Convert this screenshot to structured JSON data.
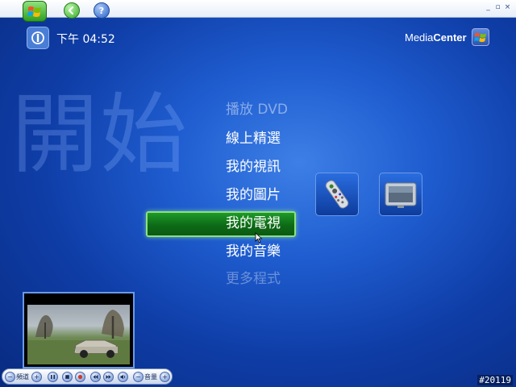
{
  "window": {
    "controls": [
      "_",
      "▫",
      "×"
    ]
  },
  "topbar": {
    "start_icon": "windows-logo-icon",
    "back_icon": "back-arrow-icon",
    "help_icon": "help-icon"
  },
  "clock": {
    "power_icon": "power-icon",
    "time": "下午 04:52"
  },
  "brand": {
    "text_regular": "Media",
    "text_bold": "Center",
    "logo_icon": "windows-logo-icon"
  },
  "heading": {
    "watermark": "開始"
  },
  "menu": {
    "items": [
      {
        "label": "播放 DVD"
      },
      {
        "label": "線上精選"
      },
      {
        "label": "我的視訊"
      },
      {
        "label": "我的圖片"
      },
      {
        "label": "我的電視"
      },
      {
        "label": "我的音樂"
      },
      {
        "label": "更多程式"
      }
    ],
    "selected_index": 4
  },
  "tiles": [
    {
      "name": "remote-tile",
      "icon": "remote-control-icon"
    },
    {
      "name": "tv-tile",
      "icon": "tv-monitor-icon"
    }
  ],
  "transport": {
    "channel_label": "頻道",
    "volume_label": "音量"
  },
  "colors": {
    "background": "#1f5dd0",
    "selection": "#1f9a2a",
    "selection_border": "#8ee07f"
  },
  "corner_id": "#20119"
}
